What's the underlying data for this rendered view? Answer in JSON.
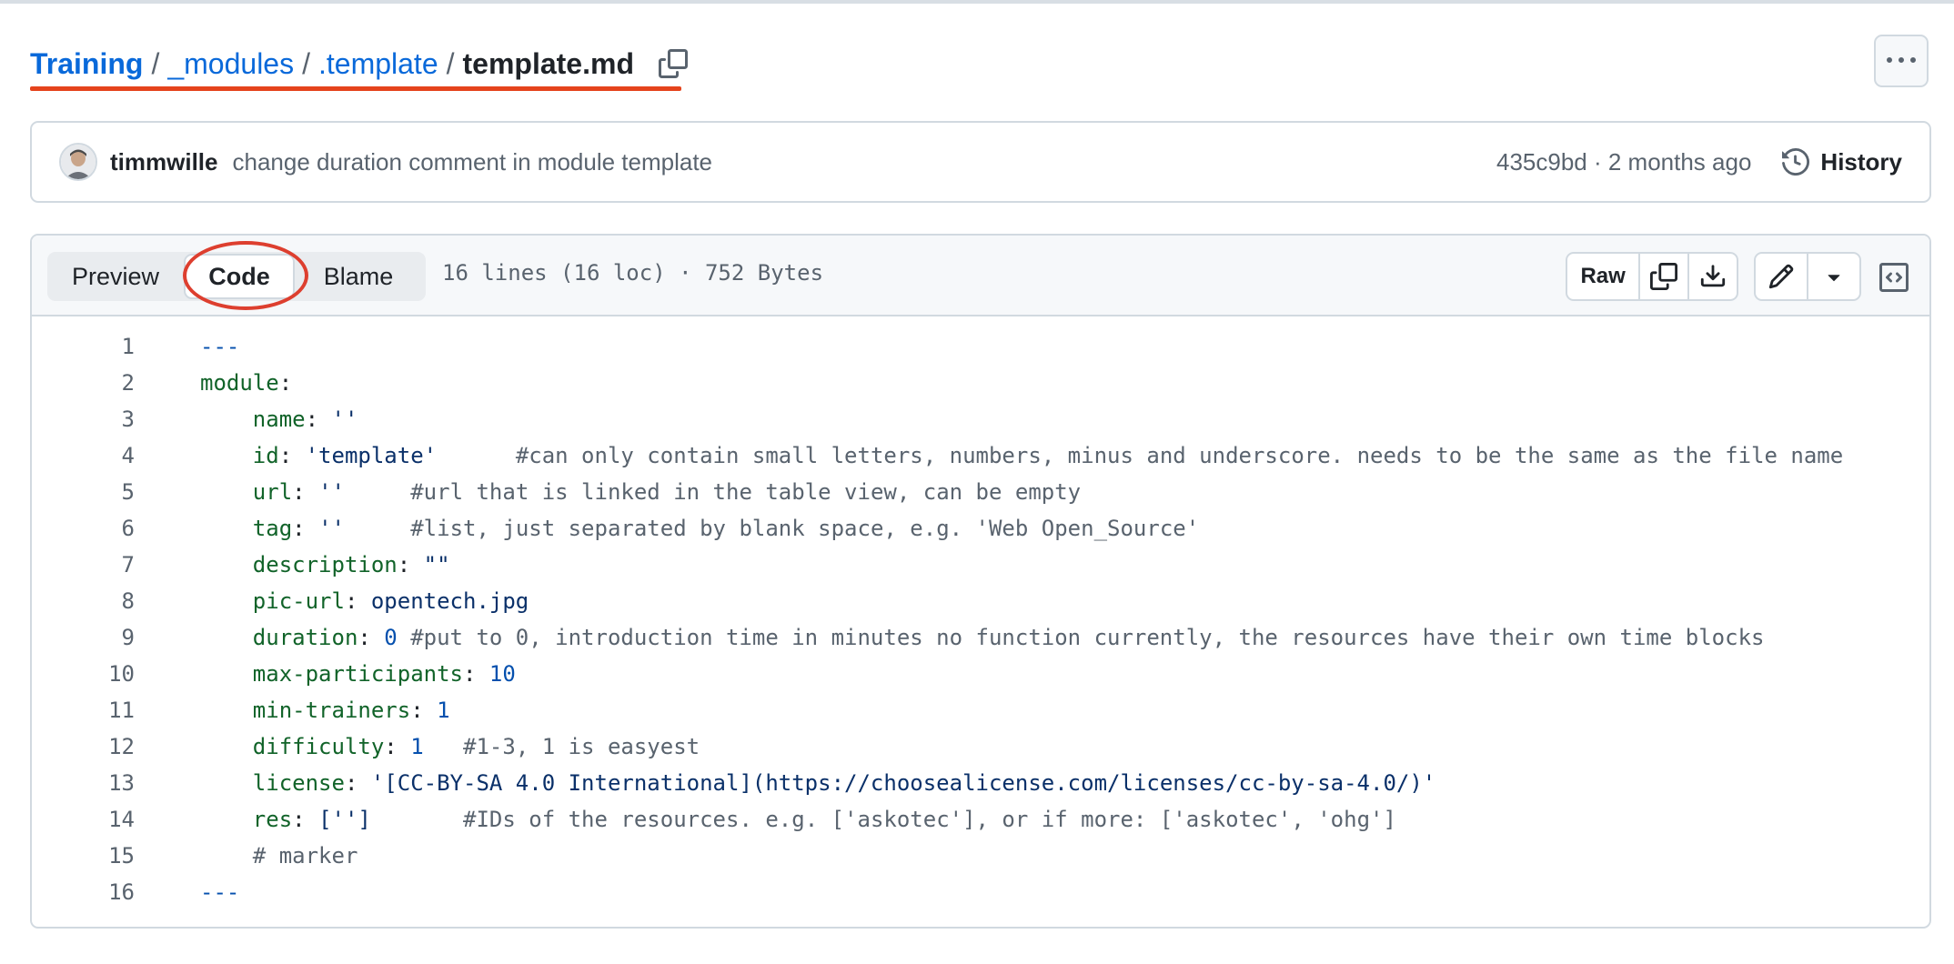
{
  "breadcrumb": {
    "root": "Training",
    "separator": "/",
    "items": [
      "_modules",
      ".template"
    ],
    "file": "template.md"
  },
  "commit": {
    "author": "timmwille",
    "message": "change duration comment in module template",
    "sha_time": "435c9bd · 2 months ago",
    "history_label": "History"
  },
  "file_header": {
    "tabs": [
      "Preview",
      "Code",
      "Blame"
    ],
    "active_tab": "Code",
    "meta": "16 lines (16 loc) · 752 Bytes",
    "raw_label": "Raw"
  },
  "code_lines": [
    {
      "num": "1",
      "tokens": [
        {
          "t": "---",
          "c": "n"
        }
      ]
    },
    {
      "num": "2",
      "tokens": [
        {
          "t": "module",
          "c": "k"
        },
        {
          "t": ":",
          "c": "p"
        }
      ]
    },
    {
      "num": "3",
      "tokens": [
        {
          "t": "    "
        },
        {
          "t": "name",
          "c": "k"
        },
        {
          "t": ": ",
          "c": "p"
        },
        {
          "t": "''",
          "c": "s"
        }
      ]
    },
    {
      "num": "4",
      "tokens": [
        {
          "t": "    "
        },
        {
          "t": "id",
          "c": "k"
        },
        {
          "t": ": ",
          "c": "p"
        },
        {
          "t": "'template'",
          "c": "s"
        },
        {
          "t": "      "
        },
        {
          "t": "#can only contain small letters, numbers, minus and underscore. needs to be the same as the file name",
          "c": "c"
        }
      ]
    },
    {
      "num": "5",
      "tokens": [
        {
          "t": "    "
        },
        {
          "t": "url",
          "c": "k"
        },
        {
          "t": ": ",
          "c": "p"
        },
        {
          "t": "''",
          "c": "s"
        },
        {
          "t": "     "
        },
        {
          "t": "#url that is linked in the table view, can be empty",
          "c": "c"
        }
      ]
    },
    {
      "num": "6",
      "tokens": [
        {
          "t": "    "
        },
        {
          "t": "tag",
          "c": "k"
        },
        {
          "t": ": ",
          "c": "p"
        },
        {
          "t": "''",
          "c": "s"
        },
        {
          "t": "     "
        },
        {
          "t": "#list, just separated by blank space, e.g. 'Web Open_Source'",
          "c": "c"
        }
      ]
    },
    {
      "num": "7",
      "tokens": [
        {
          "t": "    "
        },
        {
          "t": "description",
          "c": "k"
        },
        {
          "t": ": ",
          "c": "p"
        },
        {
          "t": "\"\"",
          "c": "s"
        }
      ]
    },
    {
      "num": "8",
      "tokens": [
        {
          "t": "    "
        },
        {
          "t": "pic-url",
          "c": "k"
        },
        {
          "t": ": ",
          "c": "p"
        },
        {
          "t": "opentech.jpg",
          "c": "s"
        }
      ]
    },
    {
      "num": "9",
      "tokens": [
        {
          "t": "    "
        },
        {
          "t": "duration",
          "c": "k"
        },
        {
          "t": ": ",
          "c": "p"
        },
        {
          "t": "0",
          "c": "n"
        },
        {
          "t": " "
        },
        {
          "t": "#put to 0, introduction time in minutes no function currently, the resources have their own time blocks",
          "c": "c"
        }
      ]
    },
    {
      "num": "10",
      "tokens": [
        {
          "t": "    "
        },
        {
          "t": "max-participants",
          "c": "k"
        },
        {
          "t": ": ",
          "c": "p"
        },
        {
          "t": "10",
          "c": "n"
        }
      ]
    },
    {
      "num": "11",
      "tokens": [
        {
          "t": "    "
        },
        {
          "t": "min-trainers",
          "c": "k"
        },
        {
          "t": ": ",
          "c": "p"
        },
        {
          "t": "1",
          "c": "n"
        }
      ]
    },
    {
      "num": "12",
      "tokens": [
        {
          "t": "    "
        },
        {
          "t": "difficulty",
          "c": "k"
        },
        {
          "t": ": ",
          "c": "p"
        },
        {
          "t": "1",
          "c": "n"
        },
        {
          "t": "   "
        },
        {
          "t": "#1-3, 1 is easyest",
          "c": "c"
        }
      ]
    },
    {
      "num": "13",
      "tokens": [
        {
          "t": "    "
        },
        {
          "t": "license",
          "c": "k"
        },
        {
          "t": ": ",
          "c": "p"
        },
        {
          "t": "'[CC-BY-SA 4.0 International](https://choosealicense.com/licenses/cc-by-sa-4.0/)'",
          "c": "s"
        }
      ]
    },
    {
      "num": "14",
      "tokens": [
        {
          "t": "    "
        },
        {
          "t": "res",
          "c": "k"
        },
        {
          "t": ": ",
          "c": "p"
        },
        {
          "t": "['']",
          "c": "s"
        },
        {
          "t": "       "
        },
        {
          "t": "#IDs of the resources. e.g. ['askotec'], or if more: ['askotec', 'ohg']",
          "c": "c"
        }
      ]
    },
    {
      "num": "15",
      "tokens": [
        {
          "t": "    "
        },
        {
          "t": "# marker",
          "c": "c"
        }
      ]
    },
    {
      "num": "16",
      "tokens": [
        {
          "t": "---",
          "c": "n"
        }
      ]
    }
  ],
  "icons": {
    "copy_path": "copy-icon",
    "more": "kebab-horizontal-icon",
    "history": "history-icon",
    "copy_raw": "copy-icon",
    "download": "download-icon",
    "edit": "pencil-icon",
    "dropdown": "triangle-down-icon",
    "symbols": "code-square-icon"
  },
  "colors": {
    "link": "#0969da",
    "annotation_red": "#dd3f2f",
    "key": "#116329",
    "string": "#0a3069",
    "number": "#0550ae",
    "comment": "#59636e"
  }
}
